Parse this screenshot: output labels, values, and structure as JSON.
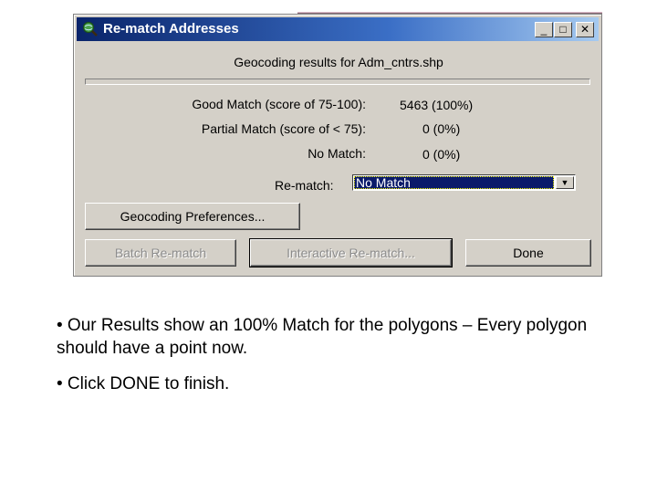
{
  "dialog": {
    "title": "Re-match Addresses",
    "subtitle": "Geocoding results for Adm_cntrs.shp",
    "titlebar_buttons": {
      "minimize": "_",
      "maximize": "□",
      "close": "✕"
    },
    "results": {
      "good_label": "Good Match (score of 75-100):",
      "good_value": "5463 (100%)",
      "partial_label": "Partial Match (score of < 75):",
      "partial_value": "0 (0%)",
      "none_label": "No Match:",
      "none_value": "0 (0%)"
    },
    "rematch": {
      "label": "Re-match:",
      "selected": "No Match"
    },
    "buttons": {
      "preferences": "Geocoding Preferences...",
      "batch": "Batch Re-match",
      "interactive": "Interactive Re-match...",
      "done": "Done"
    },
    "icons": {
      "title_icon": "magnifier-globe-icon",
      "dropdown": "chevron-down-icon"
    }
  },
  "slide": {
    "bullet_1": "• Our Results show an 100% Match for the polygons – Every polygon should have a point now.",
    "bullet_2": "• Click DONE to finish."
  },
  "colors": {
    "titlebar_start": "#0a246a",
    "titlebar_end": "#a6caf0",
    "dialog_face": "#d4d0c8",
    "selection": "#0a1a6a"
  }
}
